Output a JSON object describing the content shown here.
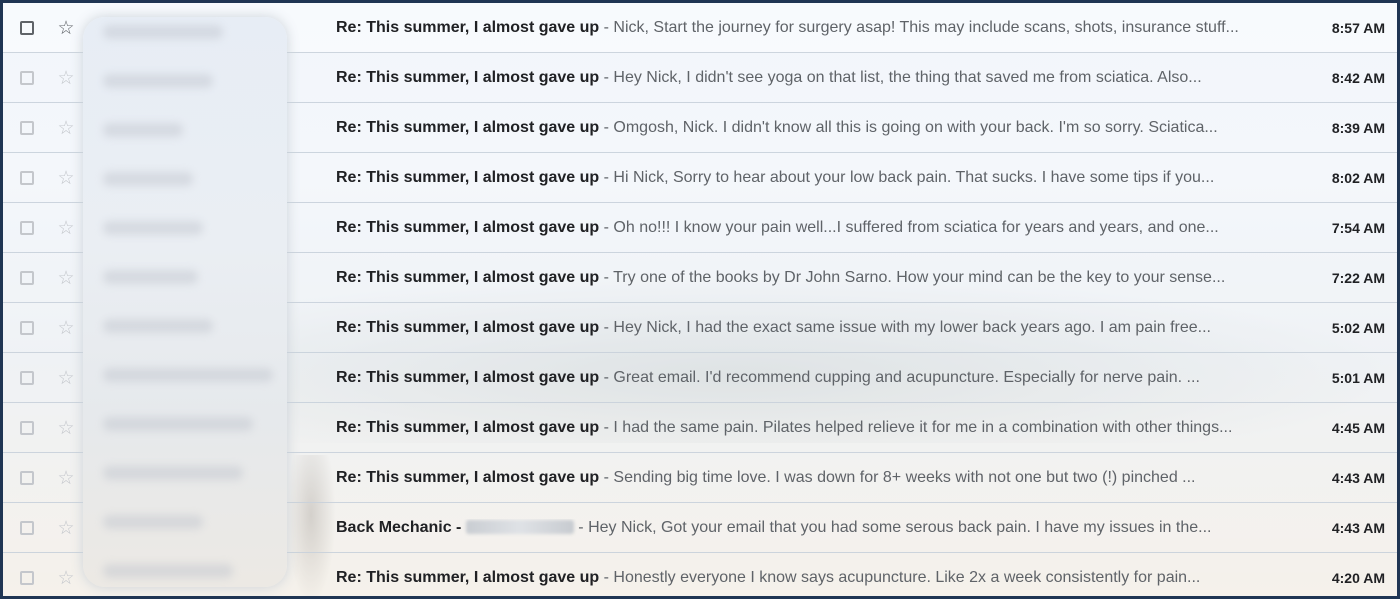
{
  "emails": [
    {
      "subject": "Re: This summer, I almost gave up",
      "snippet": "Nick, Start the journey for surgery asap! This may include scans, shots, insurance stuff...",
      "time": "8:57 AM"
    },
    {
      "subject": "Re: This summer, I almost gave up",
      "snippet": "Hey Nick, I didn't see yoga on that list, the thing that saved me from sciatica. Also...",
      "time": "8:42 AM"
    },
    {
      "subject": "Re: This summer, I almost gave up",
      "snippet": "Omgosh, Nick. I didn't know all this is going on with your back. I'm so sorry. Sciatica...",
      "time": "8:39 AM"
    },
    {
      "subject": "Re: This summer, I almost gave up",
      "snippet": "Hi Nick, Sorry to hear about your low back pain. That sucks. I have some tips if you...",
      "time": "8:02 AM"
    },
    {
      "subject": "Re: This summer, I almost gave up",
      "snippet": "Oh no!!! I know your pain well...I suffered from sciatica for years and years, and one...",
      "time": "7:54 AM"
    },
    {
      "subject": "Re: This summer, I almost gave up",
      "snippet": "Try one of the books by Dr John Sarno. How your mind can be the key to your sense...",
      "time": "7:22 AM"
    },
    {
      "subject": "Re: This summer, I almost gave up",
      "snippet": "Hey Nick, I had the exact same issue with my lower back years ago. I am pain free...",
      "time": "5:02 AM"
    },
    {
      "subject": "Re: This summer, I almost gave up",
      "snippet": "Great email. I'd recommend cupping and acupuncture. Especially for nerve pain. ...",
      "time": "5:01 AM"
    },
    {
      "subject": "Re: This summer, I almost gave up",
      "snippet": "I had the same pain. Pilates helped relieve it for me in a combination with other things...",
      "time": "4:45 AM"
    },
    {
      "subject": "Re: This summer, I almost gave up",
      "snippet": "Sending big time love. I was down for 8+ weeks with not one but two (!) pinched ...",
      "time": "4:43 AM"
    },
    {
      "subject": "Back Mechanic -",
      "snippet": "Hey Nick, Got your email that you had some serous back pain. I have my issues in the...",
      "time": "4:43 AM",
      "subject_redacted": true
    },
    {
      "subject": "Re: This summer, I almost gave up",
      "snippet": "Honestly everyone I know says acupuncture. Like 2x a week consistently for pain...",
      "time": "4:20 AM"
    }
  ],
  "separator": " - ",
  "colors": {
    "frame_border": "#1f3553",
    "subject_text": "#202124",
    "snippet_text": "#5f6368"
  }
}
